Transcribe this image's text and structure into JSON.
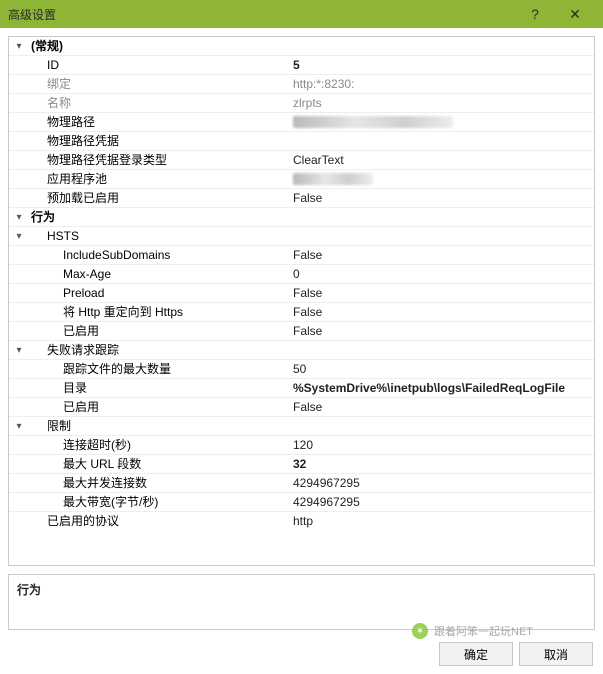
{
  "window": {
    "title": "高级设置",
    "help": "?",
    "close": "✕"
  },
  "groups": {
    "general": {
      "label": "(常规)"
    },
    "behavior": {
      "label": "行为"
    },
    "hsts": {
      "label": "HSTS"
    },
    "frt": {
      "label": "失败请求跟踪"
    },
    "limit": {
      "label": "限制"
    }
  },
  "props": {
    "id": {
      "key": "ID",
      "val": "5"
    },
    "binding": {
      "key": "绑定",
      "val": "http:*:8230:"
    },
    "name": {
      "key": "名称",
      "val": "zlrpts"
    },
    "physpath": {
      "key": "物理路径",
      "val": ""
    },
    "physcred": {
      "key": "物理路径凭据",
      "val": ""
    },
    "physcredtype": {
      "key": "物理路径凭据登录类型",
      "val": "ClearText"
    },
    "apppool": {
      "key": "应用程序池",
      "val": ""
    },
    "preload": {
      "key": "预加载已启用",
      "val": "False"
    },
    "hsts_inc": {
      "key": "IncludeSubDomains",
      "val": "False"
    },
    "hsts_max": {
      "key": "Max-Age",
      "val": "0"
    },
    "hsts_pre": {
      "key": "Preload",
      "val": "False"
    },
    "hsts_red": {
      "key": "将 Http 重定向到 Https",
      "val": "False"
    },
    "hsts_en": {
      "key": "已启用",
      "val": "False"
    },
    "frt_max": {
      "key": "跟踪文件的最大数量",
      "val": "50"
    },
    "frt_dir": {
      "key": "目录",
      "val": "%SystemDrive%\\inetpub\\logs\\FailedReqLogFile"
    },
    "frt_en": {
      "key": "已启用",
      "val": "False"
    },
    "lim_conn": {
      "key": "连接超时(秒)",
      "val": "120"
    },
    "lim_url": {
      "key": "最大 URL 段数",
      "val": "32"
    },
    "lim_maxc": {
      "key": "最大并发连接数",
      "val": "4294967295"
    },
    "lim_bw": {
      "key": "最大带宽(字节/秒)",
      "val": "4294967295"
    },
    "proto": {
      "key": "已启用的协议",
      "val": "http"
    }
  },
  "description": {
    "title": "行为"
  },
  "buttons": {
    "ok": "确定",
    "cancel": "取消"
  },
  "watermark": {
    "text": "跟着阿笨一起玩NET"
  }
}
